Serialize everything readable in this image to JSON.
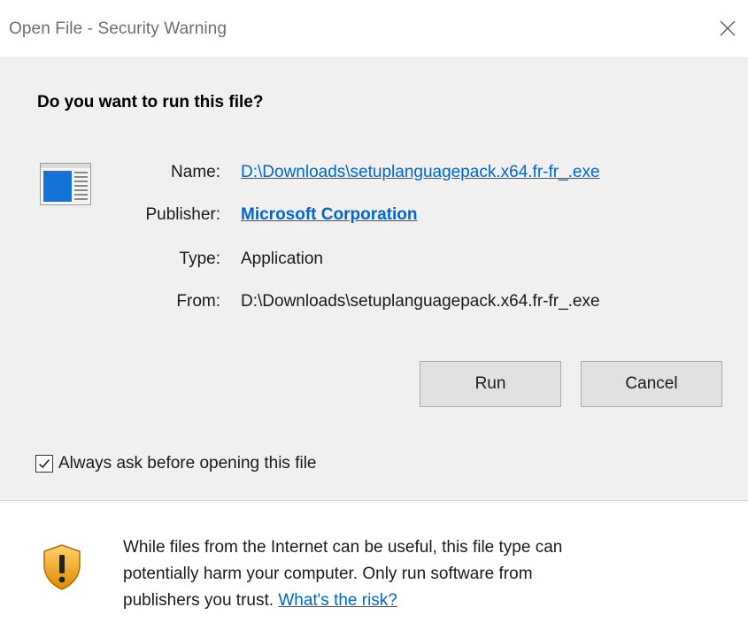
{
  "window": {
    "title": "Open File - Security Warning",
    "close_icon": "close-icon"
  },
  "dialog": {
    "heading": "Do you want to run this file?",
    "file_icon": "application-window-icon",
    "fields": {
      "name_label": "Name:",
      "name_value": "D:\\Downloads\\setuplanguagepack.x64.fr-fr_.exe",
      "publisher_label": "Publisher:",
      "publisher_value": "Microsoft Corporation",
      "type_label": "Type:",
      "type_value": "Application",
      "from_label": "From:",
      "from_value": "D:\\Downloads\\setuplanguagepack.x64.fr-fr_.exe"
    },
    "buttons": {
      "run": "Run",
      "cancel": "Cancel"
    },
    "checkbox": {
      "label": "Always ask before opening this file",
      "checked": true
    }
  },
  "footer": {
    "shield_icon": "shield-warning-icon",
    "text_line1": "While files from the Internet can be useful, this file type can",
    "text_line2": "potentially harm your computer. Only run software from",
    "text_line3_prefix": "publishers you trust. ",
    "risk_link": "What's the risk?"
  },
  "colors": {
    "link": "#0066cc",
    "background": "#f0f0f0",
    "panel": "#ffffff",
    "button": "#e1e1e1",
    "shield_orange": "#f5a623"
  }
}
